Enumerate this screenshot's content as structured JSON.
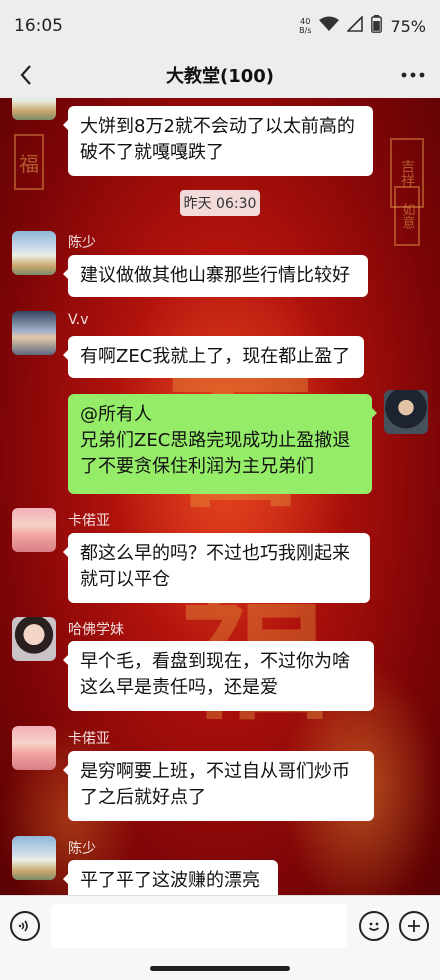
{
  "status_bar": {
    "time": "16:05",
    "net_speed_value": "40",
    "net_speed_unit": "B/s",
    "battery": "75%",
    "icons": [
      "wifi-icon",
      "signal-icon",
      "battery-icon"
    ]
  },
  "nav": {
    "title": "大教堂(100)",
    "back_icon": "chevron-left-icon",
    "more_icon": "more-dots-icon"
  },
  "chat": {
    "timestamp": "昨天 06:30",
    "messages": [
      {
        "sender": "",
        "text_lines": [
          "大饼到8万2就不会动了以太前高的",
          "破不了就嘎嘎跌了"
        ],
        "side": "left"
      },
      {
        "sender": "陈少",
        "text_lines": [
          "建议做做其他山寨那些行情比较好"
        ],
        "side": "left"
      },
      {
        "sender": "V.v",
        "text_lines": [
          "有啊ZEC我就上了，现在都止盈了"
        ],
        "side": "left"
      },
      {
        "sender": "",
        "text_lines": [
          "@所有人",
          "兄弟们ZEC思路完现成功止盈撤退",
          "了不要贪保住利润为主兄弟们"
        ],
        "side": "right"
      },
      {
        "sender": "卡偌亚",
        "text_lines": [
          "都这么早的吗？不过也巧我刚起来",
          "就可以平仓"
        ],
        "side": "left"
      },
      {
        "sender": "哈佛学妹",
        "text_lines": [
          "早个毛，看盘到现在，不过你为啥",
          "这么早是责任吗，还是爱"
        ],
        "side": "left"
      },
      {
        "sender": "卡偌亚",
        "text_lines": [
          "是穷啊要上班，不过自从哥们炒币",
          "了之后就好点了"
        ],
        "side": "left"
      },
      {
        "sender": "陈少",
        "text_lines": [
          "平了平了这波赚的漂亮"
        ],
        "side": "left"
      }
    ]
  },
  "background": {
    "seal_left": "福",
    "seal_right_top": "吉祥",
    "seal_right_mid": "如意"
  },
  "input_bar": {
    "voice_icon": "voice-icon",
    "emoji_icon": "emoji-icon",
    "plus_icon": "plus-icon",
    "placeholder": ""
  },
  "colors": {
    "bubble_self": "#95ec69",
    "bubble_other": "#ffffff",
    "background_red": "#b0120c"
  }
}
